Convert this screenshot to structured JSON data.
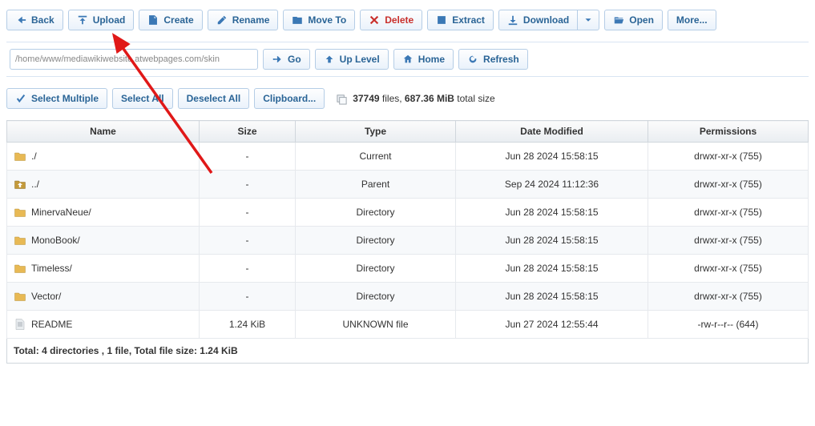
{
  "toolbar1": {
    "back": "Back",
    "upload": "Upload",
    "create": "Create",
    "rename": "Rename",
    "move": "Move To",
    "delete": "Delete",
    "extract": "Extract",
    "download": "Download",
    "open": "Open",
    "more": "More..."
  },
  "pathbar": {
    "path": "/home/www/mediawikiwebsite.atwebpages.com/skin",
    "go": "Go",
    "up": "Up Level",
    "home": "Home",
    "refresh": "Refresh"
  },
  "selectbar": {
    "select_multiple": "Select Multiple",
    "select_all": "Select All",
    "deselect_all": "Deselect All",
    "clipboard": "Clipboard..."
  },
  "stats": {
    "count": "37749",
    "count_label": " files, ",
    "size": "687.36 MiB",
    "size_label": " total size"
  },
  "columns": {
    "name": "Name",
    "size": "Size",
    "type": "Type",
    "date": "Date Modified",
    "perm": "Permissions"
  },
  "rows": [
    {
      "icon": "folder",
      "name": "./",
      "size": "-",
      "type": "Current",
      "date": "Jun 28 2024 15:58:15",
      "perm": "drwxr-xr-x (755)"
    },
    {
      "icon": "up",
      "name": "../",
      "size": "-",
      "type": "Parent",
      "date": "Sep 24 2024 11:12:36",
      "perm": "drwxr-xr-x (755)"
    },
    {
      "icon": "folder",
      "name": "MinervaNeue/",
      "size": "-",
      "type": "Directory",
      "date": "Jun 28 2024 15:58:15",
      "perm": "drwxr-xr-x (755)"
    },
    {
      "icon": "folder",
      "name": "MonoBook/",
      "size": "-",
      "type": "Directory",
      "date": "Jun 28 2024 15:58:15",
      "perm": "drwxr-xr-x (755)"
    },
    {
      "icon": "folder",
      "name": "Timeless/",
      "size": "-",
      "type": "Directory",
      "date": "Jun 28 2024 15:58:15",
      "perm": "drwxr-xr-x (755)"
    },
    {
      "icon": "folder",
      "name": "Vector/",
      "size": "-",
      "type": "Directory",
      "date": "Jun 28 2024 15:58:15",
      "perm": "drwxr-xr-x (755)"
    },
    {
      "icon": "file",
      "name": "README",
      "size": "1.24 KiB",
      "type": "UNKNOWN file",
      "date": "Jun 27 2024 12:55:44",
      "perm": "-rw-r--r-- (644)"
    }
  ],
  "footer": {
    "text": "Total: 4 directories , 1 file, Total file size: 1.24 KiB"
  }
}
